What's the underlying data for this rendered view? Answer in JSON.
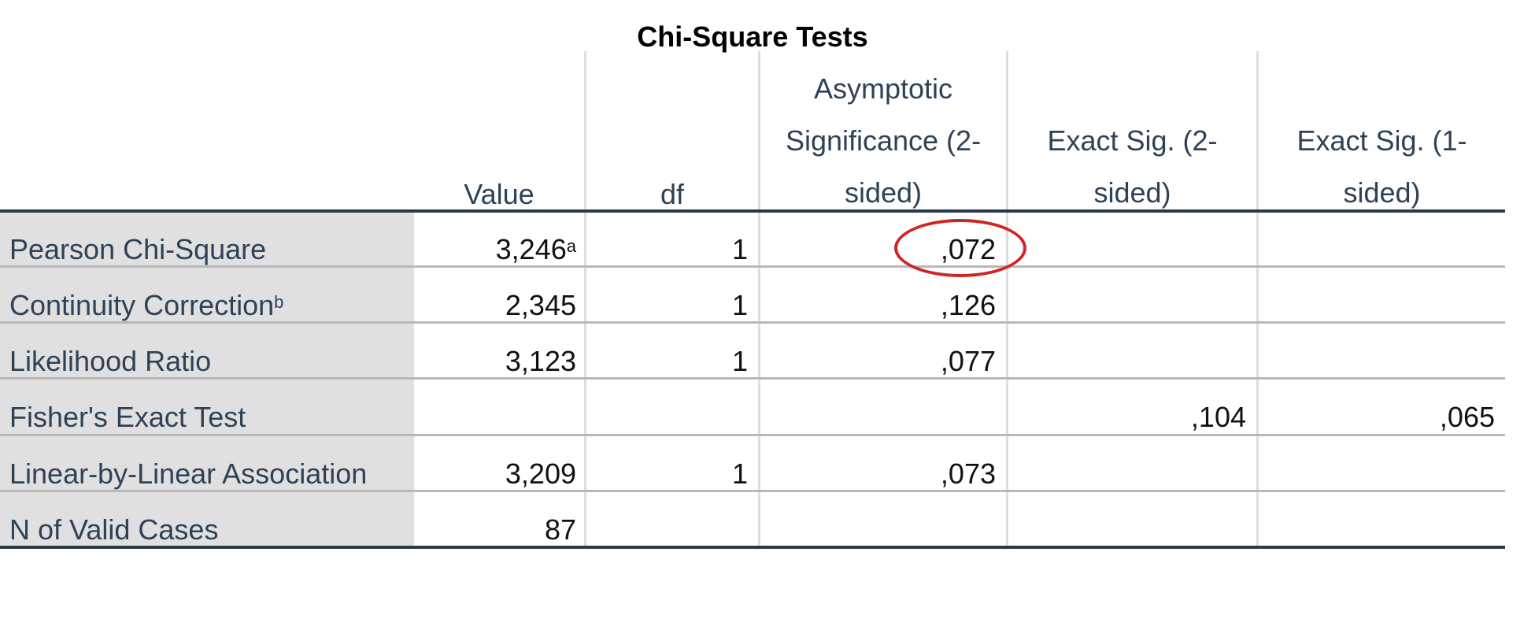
{
  "table": {
    "title": "Chi-Square Tests",
    "headers": {
      "value": "Value",
      "df": "df",
      "asymp_line1": "Asymptotic",
      "asymp_line2": "Significance (2-",
      "asymp_line3": "sided)",
      "exact2_line1": "Exact Sig. (2-",
      "exact2_line2": "sided)",
      "exact1_line1": "Exact Sig. (1-",
      "exact1_line2": "sided)"
    },
    "rows": [
      {
        "label": "Pearson Chi-Square",
        "label_sup": "",
        "value": "3,246",
        "value_sup": "a",
        "df": "1",
        "asymp": ",072",
        "exact2": "",
        "exact1": ""
      },
      {
        "label": "Continuity Correction",
        "label_sup": "b",
        "value": "2,345",
        "value_sup": "",
        "df": "1",
        "asymp": ",126",
        "exact2": "",
        "exact1": ""
      },
      {
        "label": "Likelihood Ratio",
        "label_sup": "",
        "value": "3,123",
        "value_sup": "",
        "df": "1",
        "asymp": ",077",
        "exact2": "",
        "exact1": ""
      },
      {
        "label": "Fisher's Exact Test",
        "label_sup": "",
        "value": "",
        "value_sup": "",
        "df": "",
        "asymp": "",
        "exact2": ",104",
        "exact1": ",065"
      },
      {
        "label": "Linear-by-Linear Association",
        "label_sup": "",
        "value": "3,209",
        "value_sup": "",
        "df": "1",
        "asymp": ",073",
        "exact2": "",
        "exact1": ""
      },
      {
        "label": "N of Valid Cases",
        "label_sup": "",
        "value": "87",
        "value_sup": "",
        "df": "",
        "asymp": "",
        "exact2": "",
        "exact1": ""
      }
    ]
  },
  "annotation": {
    "highlight_color": "#d22424"
  }
}
